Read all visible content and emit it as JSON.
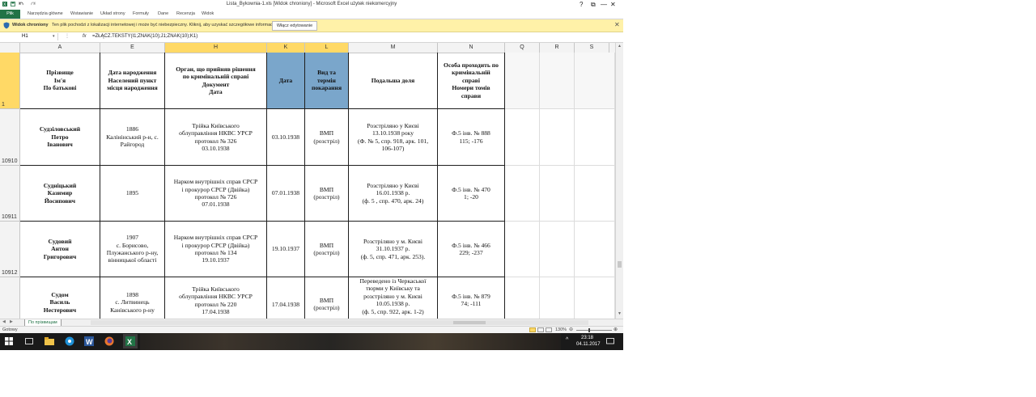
{
  "window": {
    "title": "Lista_Bykownia-1.xls  [Widok chroniony]  -  Microsoft Excel użytek niekomercyjny",
    "controls": {
      "help": "?",
      "restore": "⧉",
      "minimize": "—",
      "maximize": "☐",
      "close": "✕"
    }
  },
  "ribbon": {
    "file": "Plik",
    "tabs": [
      "Narzędzia główne",
      "Wstawianie",
      "Układ strony",
      "Formuły",
      "Dane",
      "Recenzja",
      "Widok"
    ]
  },
  "protected_view": {
    "title": "Widok chroniony",
    "message": "Ten plik pochodzi z lokalizacji internetowej i może być niebezpieczny. Kliknij, aby uzyskać szczegółowe informacje.",
    "button": "Włącz edytowanie",
    "close": "✕",
    "color": "#fff1a8"
  },
  "formula_bar": {
    "name_box": "H1",
    "fx": "fx",
    "formula": "=ZŁĄCZ.TEKSTY(I1;ZNAK(10);J1;ZNAK(10);K1)"
  },
  "columns": [
    "A",
    "E",
    "H",
    "K",
    "L",
    "M",
    "N",
    "Q",
    "R",
    "S"
  ],
  "header_row": {
    "number": "1",
    "cells": [
      "Прізвище\nІм'я\nПо батькові",
      "Дата народження\nНаселений пункт\nмісця народження",
      "Орган, що прийняв рішення\nпо кримінальній справі\nДокумент\nДата",
      "Дата",
      "Вид та\nтермін\nпокарання",
      "Подальша доля",
      "Особа проходить по\nкримінальній\nсправі\nНомери томів\nсправи"
    ]
  },
  "rows": [
    {
      "number": "10910",
      "cells": [
        "Судзіловський\nПетро\nІванович",
        "1886\nКалінінський р-н, с.\nРайгород",
        "Трійка Київського\nоблуправління НКВС УРСР\nпротокол № 326\n03.10.1938",
        "03.10.1938",
        "ВМП\n(розстріл)",
        "Розстріляно у Києві\n13.10.1938 року\n(Ф. № 5, спр. 918, арк. 101,\n106-107)",
        "Ф.5 інв. № 888\n115; -176"
      ]
    },
    {
      "number": "10911",
      "cells": [
        "Судніцький\nКазимир\nЙосипович",
        "1895",
        "Нарком внутрішніх справ СРСР\nі прокурор СРСР (Двійка)\nпротокол № 726\n07.01.1938",
        "07.01.1938",
        "ВМП\n(розстріл)",
        "Розстріляно у Києві\n16.01.1938 р.\n(ф. 5 , спр. 470, арк. 24)",
        "Ф.5 інв. № 470\n1; -20"
      ]
    },
    {
      "number": "10912",
      "cells": [
        "Судовий\nАнтон\nГригорович",
        "1907\nс. Борисово,\nПлужанського р-ну,\nвінницької області",
        "Нарком внутрішніх справ СРСР\nі прокурор СРСР (Двійка)\nпротокол № 134\n19.10.1937",
        "19.10.1937",
        "ВМП\n(розстріл)",
        "Розстріляно у м. Києві\n31.10.1937 р.\n(ф. 5, спр. 471, арк. 253).",
        "Ф.5 інв. № 466\n229; -237"
      ]
    },
    {
      "number": "",
      "cells": [
        "Судом\nВасиль\nНестерович",
        "1898\nс. Литвинець\nКанівського р-ну",
        "Трійка Київського\nоблуправління НКВС УРСР\nпротокол № 220\n17.04.1938",
        "17.04.1938",
        "ВМП\n(розстріл)",
        "Переведено із Черкаської\nтюрми у Київську та\nрозстріляно у м. Києві\n10.05.1938 р.\n(ф. 5, спр. 922, арк. 1-2)",
        "Ф.5 інв. № 879\n74; -111"
      ]
    }
  ],
  "sheet_tab": "По прізвищам",
  "status": {
    "ready": "Gotowy",
    "zoom": "130%"
  },
  "taskbar": {
    "time": "23:18",
    "date": "04.11.2017",
    "icons": [
      "windows-start-icon",
      "task-view-icon",
      "file-explorer-icon",
      "store-icon",
      "word-icon",
      "firefox-icon",
      "excel-icon"
    ]
  }
}
